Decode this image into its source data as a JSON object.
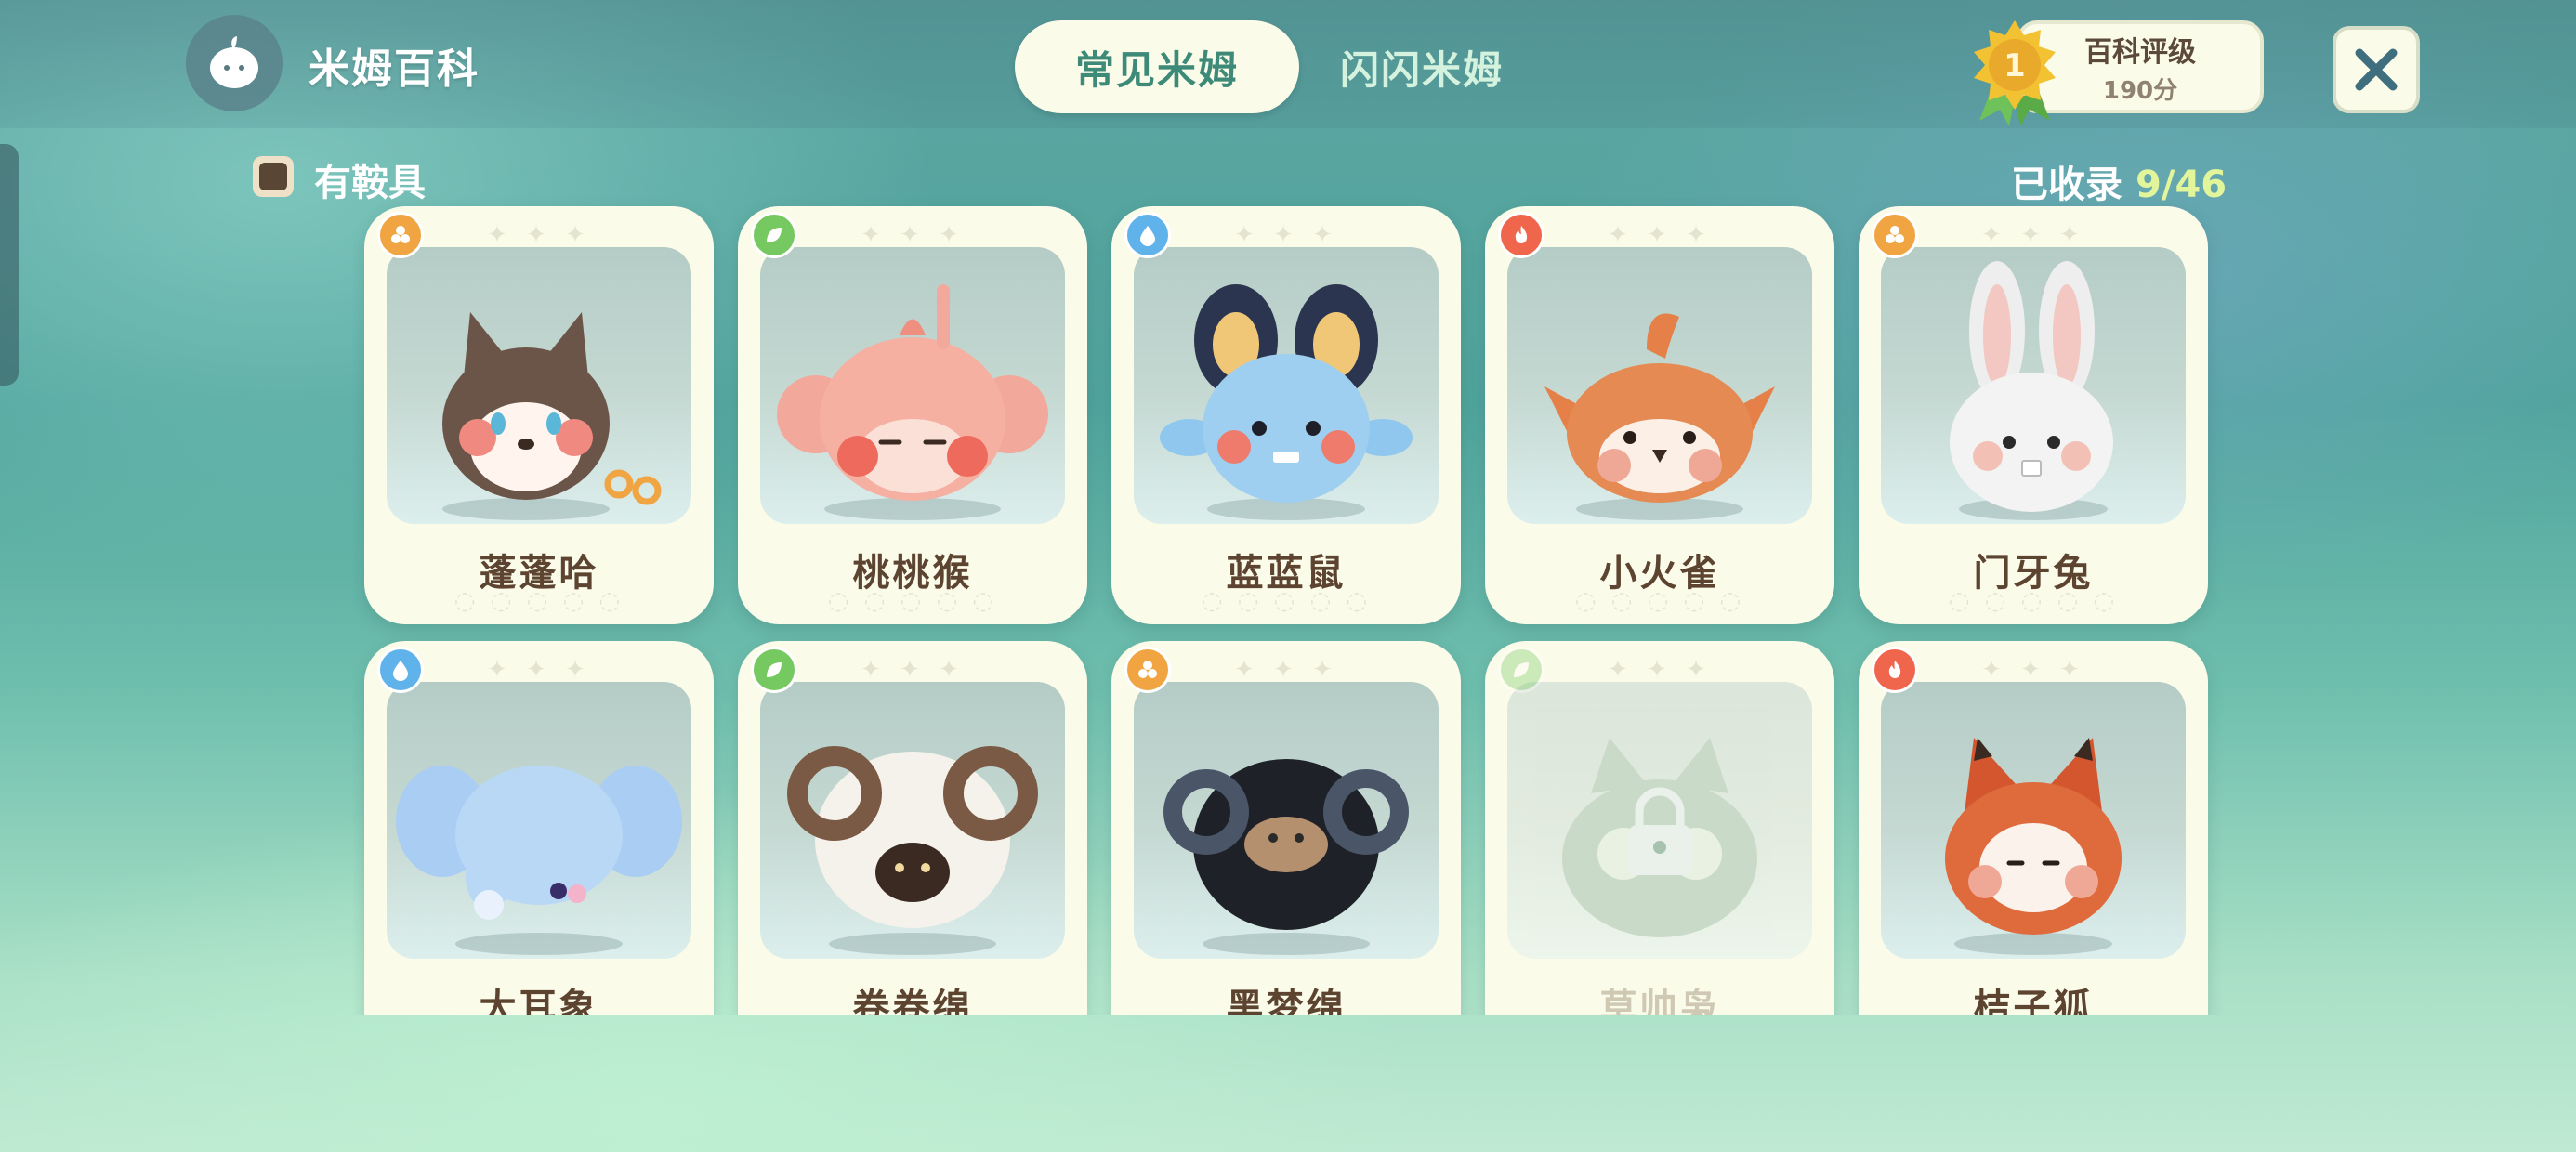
{
  "header": {
    "app_title": "米姆百科",
    "tabs": [
      {
        "label": "常见米姆",
        "active": true
      },
      {
        "label": "闪闪米姆",
        "active": false
      }
    ],
    "rating": {
      "rank": "1",
      "label": "百科评级",
      "score": "190分"
    },
    "close_icon": "close-icon"
  },
  "filter": {
    "saddle_label": "有鞍具"
  },
  "collection": {
    "label": "已收录",
    "count": "9/46"
  },
  "colors": {
    "fire": "#f0664d",
    "water": "#5fb2ea",
    "grass": "#76c860",
    "ground": "#f0a442",
    "accent": "#3e8a79",
    "card_bg": "#fbfbea"
  },
  "cards": [
    {
      "name": "蓬蓬哈",
      "element": "ground",
      "locked": false
    },
    {
      "name": "桃桃猴",
      "element": "grass",
      "locked": false
    },
    {
      "name": "蓝蓝鼠",
      "element": "water",
      "locked": false
    },
    {
      "name": "小火雀",
      "element": "fire",
      "locked": false
    },
    {
      "name": "门牙兔",
      "element": "ground",
      "locked": false
    },
    {
      "name": "大耳象",
      "element": "water",
      "locked": false
    },
    {
      "name": "卷卷绵",
      "element": "grass",
      "locked": false
    },
    {
      "name": "黑梦绵",
      "element": "ground",
      "locked": false
    },
    {
      "name": "草帅枭",
      "element": "grass",
      "locked": true
    },
    {
      "name": "桔子狐",
      "element": "fire",
      "locked": false
    }
  ]
}
